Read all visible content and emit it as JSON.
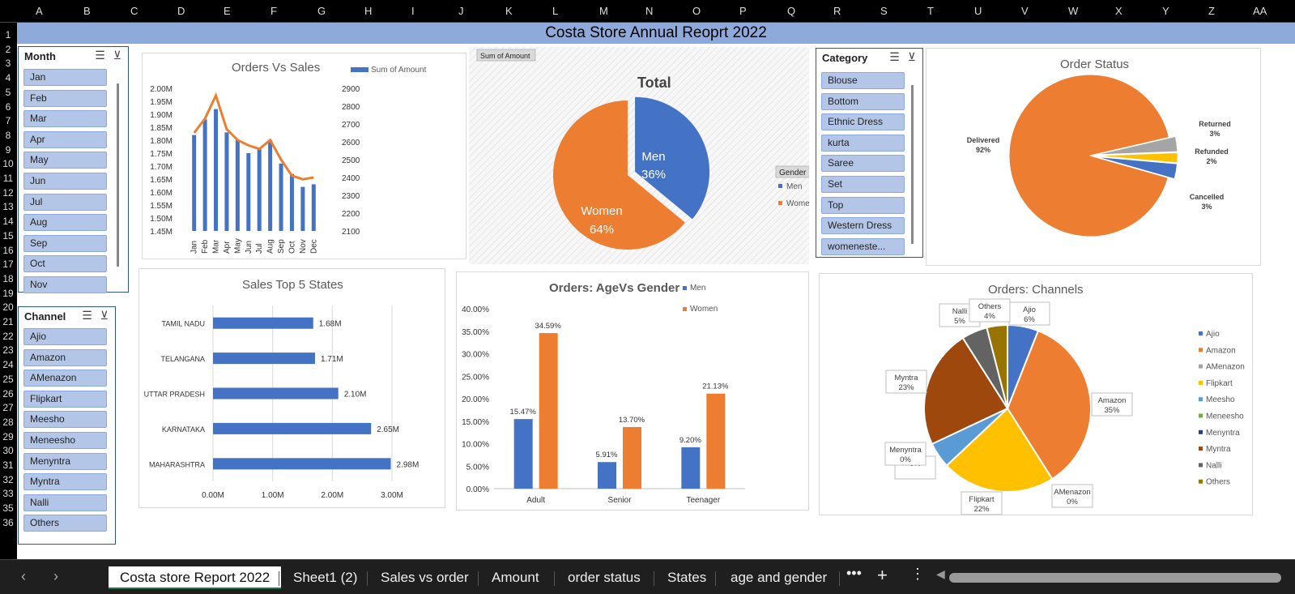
{
  "columns": [
    "A",
    "B",
    "C",
    "D",
    "E",
    "F",
    "G",
    "H",
    "I",
    "J",
    "K",
    "L",
    "M",
    "N",
    "O",
    "P",
    "Q",
    "R",
    "S",
    "T",
    "U",
    "V",
    "W",
    "X",
    "Y",
    "Z",
    "AA"
  ],
  "rows": [
    "1",
    "2",
    "3",
    "4",
    "5",
    "6",
    "7",
    "8",
    "9",
    "10",
    "11",
    "12",
    "13",
    "14",
    "15",
    "16",
    "17",
    "18",
    "19",
    "20",
    "21",
    "22",
    "23",
    "24",
    "25",
    "26",
    "27",
    "28",
    "29",
    "30",
    "31",
    "32",
    "33",
    "35",
    "36"
  ],
  "title": "Costa Store Annual Reoprt 2022",
  "month_slicer": {
    "header": "Month",
    "items": [
      "Jan",
      "Feb",
      "Mar",
      "Apr",
      "May",
      "Jun",
      "Jul",
      "Aug",
      "Sep",
      "Oct",
      "Nov"
    ]
  },
  "category_slicer": {
    "header": "Category",
    "items": [
      "Blouse",
      "Bottom",
      "Ethnic Dress",
      "kurta",
      "Saree",
      "Set",
      "Top",
      "Western Dress",
      "womeneste..."
    ]
  },
  "channel_slicer": {
    "header": "Channel",
    "items": [
      "Ajio",
      "Amazon",
      "AMenazon",
      "Flipkart",
      "Meesho",
      "Meneesho",
      "Menyntra",
      "Myntra",
      "Nalli",
      "Others"
    ]
  },
  "orders_vs_sales": {
    "title": "Orders Vs Sales",
    "legend": "Sum of Amount",
    "left_ticks": [
      "2.00M",
      "1.95M",
      "1.90M",
      "1.85M",
      "1.80M",
      "1.75M",
      "1.70M",
      "1.65M",
      "1.60M",
      "1.55M",
      "1.50M",
      "1.45M"
    ],
    "right_ticks": [
      "2900",
      "2800",
      "2700",
      "2600",
      "2500",
      "2400",
      "2300",
      "2200",
      "2100"
    ]
  },
  "gender_pie": {
    "button": "Sum of Amount",
    "title": "Total",
    "filter_label": "Gender",
    "men_label": "Men",
    "men_pct": "36%",
    "women_label": "Women",
    "women_pct": "64%",
    "legend": [
      "Men",
      "Women"
    ]
  },
  "order_status": {
    "title": "Order Status",
    "delivered": "Delivered",
    "delivered_pct": "92%",
    "returned": "Returned",
    "returned_pct": "3%",
    "refunded": "Refunded",
    "refunded_pct": "2%",
    "cancelled": "Cancelled",
    "cancelled_pct": "3%"
  },
  "top_states": {
    "title": "Sales Top 5 States",
    "x_ticks": [
      "0.00M",
      "1.00M",
      "2.00M",
      "3.00M"
    ]
  },
  "age_gender": {
    "title": "Orders: AgeVs Gender",
    "legend": [
      "Men",
      "Women"
    ],
    "y_ticks": [
      "40.00%",
      "35.00%",
      "30.00%",
      "25.00%",
      "20.00%",
      "15.00%",
      "10.00%",
      "5.00%",
      "0.00%"
    ]
  },
  "channels": {
    "title": "Orders: Channels",
    "callouts": [
      {
        "name": "Ajio",
        "pct": "6%"
      },
      {
        "name": "Amazon",
        "pct": "35%"
      },
      {
        "name": "AMenazon",
        "pct": "0%"
      },
      {
        "name": "Flipkart",
        "pct": "22%"
      },
      {
        "name": "5%",
        "pct": ""
      },
      {
        "name": "Menyntra",
        "pct": "0%"
      },
      {
        "name": "Myntra",
        "pct": "23%"
      },
      {
        "name": "Nalli",
        "pct": "5%"
      },
      {
        "name": "Others",
        "pct": "4%"
      }
    ],
    "legend": [
      "Ajio",
      "Amazon",
      "AMenazon",
      "Flipkart",
      "Meesho",
      "Meneesho",
      "Menyntra",
      "Myntra",
      "Nalli",
      "Others"
    ]
  },
  "tabs": [
    "Costa store Report 2022",
    "Sheet1 (2)",
    "Sales vs order",
    "Amount",
    "order status",
    "States",
    "age and gender"
  ],
  "colors": {
    "blue": "#4472c4",
    "orange": "#ed7d31",
    "gray": "#a5a5a5",
    "gold": "#ffc000",
    "lightblue": "#5b9bd5",
    "green": "#70ad47",
    "brown": "#9e480e",
    "darkgray": "#636363",
    "olive": "#997300",
    "header": "#8eaadb",
    "slicer_item": "#b4c6e7"
  },
  "chart_data": [
    {
      "type": "bar",
      "title": "Orders Vs Sales",
      "categories": [
        "Jan",
        "Feb",
        "Mar",
        "Apr",
        "May",
        "Jun",
        "Jul",
        "Aug",
        "Sep",
        "Oct",
        "Nov",
        "Dec"
      ],
      "series": [
        {
          "name": "Sum of Amount",
          "values": [
            1.82,
            1.88,
            1.92,
            1.83,
            1.8,
            1.75,
            1.77,
            1.8,
            1.71,
            1.67,
            1.62,
            1.63
          ]
        },
        {
          "values": [
            2650,
            2730,
            2860,
            2670,
            2610,
            2580,
            2560,
            2610,
            2500,
            2410,
            2390,
            2400
          ],
          "axis": "right",
          "type": "line"
        }
      ],
      "ylim": [
        1.45,
        2.0
      ],
      "y2lim": [
        2100,
        2900
      ]
    },
    {
      "type": "pie",
      "title": "Total",
      "categories": [
        "Men",
        "Women"
      ],
      "values": [
        36,
        64
      ]
    },
    {
      "type": "pie",
      "title": "Order Status",
      "categories": [
        "Delivered",
        "Returned",
        "Refunded",
        "Cancelled"
      ],
      "values": [
        92,
        3,
        2,
        3
      ]
    },
    {
      "type": "bar",
      "title": "Sales Top 5 States",
      "categories": [
        "TAMIL NADU",
        "TELANGANA",
        "UTTAR PRADESH",
        "KARNATAKA",
        "MAHARASHTRA"
      ],
      "values": [
        1.68,
        1.71,
        2.1,
        2.65,
        2.98
      ],
      "data_labels": [
        "1.68M",
        "1.71M",
        "2.10M",
        "2.65M",
        "2.98M"
      ],
      "xlim": [
        0,
        3.0
      ]
    },
    {
      "type": "bar",
      "title": "Orders: AgeVs Gender",
      "categories": [
        "Adult",
        "Senior",
        "Teenager"
      ],
      "series": [
        {
          "name": "Men",
          "values": [
            15.47,
            5.91,
            9.2
          ]
        },
        {
          "name": "Women",
          "values": [
            34.59,
            13.7,
            21.13
          ]
        }
      ],
      "data_labels": [
        [
          "15.47%",
          "5.91%",
          "9.20%"
        ],
        [
          "34.59%",
          "13.70%",
          "21.13%"
        ]
      ],
      "ylim": [
        0,
        40
      ]
    },
    {
      "type": "pie",
      "title": "Orders: Channels",
      "categories": [
        "Ajio",
        "Amazon",
        "AMenazon",
        "Flipkart",
        "Meesho",
        "Meneesho",
        "Menyntra",
        "Myntra",
        "Nalli",
        "Others"
      ],
      "values": [
        6,
        35,
        0,
        22,
        5,
        0,
        0,
        23,
        5,
        4
      ]
    }
  ]
}
